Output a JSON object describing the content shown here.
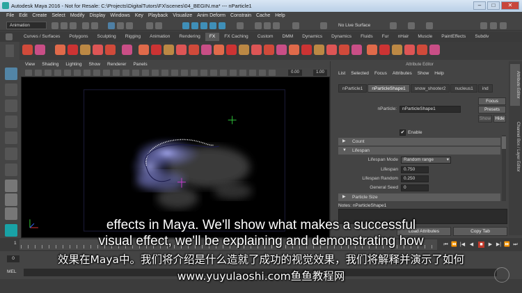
{
  "window": {
    "title": "Autodesk Maya 2016 - Not for Resale: C:\\Projects\\DigitalTutors\\FX\\scenes\\04_BEGIN.ma*  ---  nParticle1",
    "minimize": "–",
    "maximize": "□",
    "close": "✕"
  },
  "menubar": [
    "File",
    "Edit",
    "Create",
    "Select",
    "Modify",
    "Display",
    "Windows",
    "Key",
    "Playback",
    "Visualize",
    "Anim Deform",
    "Constrain",
    "Cache",
    "Help"
  ],
  "statusline": {
    "mode": "Animation",
    "live_surface": "No Live Surface"
  },
  "shelf": {
    "tabs": [
      "Curves / Surfaces",
      "Polygons",
      "Sculpting",
      "Rigging",
      "Animation",
      "Rendering",
      "FX",
      "FX Caching",
      "Custom",
      "DMM",
      "Dynamics",
      "Dynamics",
      "Fluids",
      "Fur",
      "nHair",
      "Muscle",
      "PaintEffects",
      "Subdiv"
    ],
    "active_tab": "FX"
  },
  "viewport": {
    "menu": [
      "View",
      "Shading",
      "Lighting",
      "Show",
      "Renderer",
      "Panels"
    ],
    "field_a": "0.00",
    "field_b": "1.00",
    "colors": {
      "background": "#000000",
      "particle_glow": "#8a8fe0",
      "smoke": "#6a6a6a",
      "curve": "#1a1a4a"
    }
  },
  "attribute_editor": {
    "header": "Attribute Editor",
    "menu": [
      "List",
      "Selected",
      "Focus",
      "Attributes",
      "Show",
      "Help"
    ],
    "tabs": [
      "nParticle1",
      "nParticleShape1",
      "snow_shooter2",
      "nucleus1",
      "ind"
    ],
    "active_tab": "nParticleShape1",
    "node_label": "nParticle:",
    "node_value": "nParticleShape1",
    "focus": "Focus",
    "presets": "Presets",
    "show": "Show",
    "hide": "Hide",
    "enable_label": "Enable",
    "enable_checked": "✔",
    "sections": {
      "count": "Count",
      "lifespan": "Lifespan",
      "particle_size": "Particle Size"
    },
    "fields": {
      "lifespan_mode_label": "Lifespan Mode",
      "lifespan_mode_value": "Random range",
      "lifespan_label": "Lifespan",
      "lifespan_value": "0.750",
      "lifespan_random_label": "Lifespan Random",
      "lifespan_random_value": "0.250",
      "general_seed_label": "General Seed",
      "general_seed_value": "0"
    },
    "notes_label": "Notes:  nParticleShape1",
    "buttons": {
      "load": "Load Attributes",
      "copy_tab": "Copy Tab"
    },
    "side_tabs": [
      "Attribute Editor",
      "Channel Box / Layer Editor"
    ]
  },
  "timeline": {
    "start": "1",
    "controls": [
      "⏮",
      "⏪",
      "|◀",
      "◀",
      "■",
      "▶",
      "▶|",
      "⏩",
      "⏭"
    ]
  },
  "range": {
    "start": "0"
  },
  "mel": {
    "label": "MEL"
  },
  "subtitles": {
    "line1": "effects in Maya. We'll show what makes a successful",
    "line2": "visual effect, we'll be explaining and demonstrating how",
    "line3": "效果在Maya中。我们将介绍是什么造就了成功的视觉效果，我们将解释并演示了如何",
    "line4": "www.yuyulaoshi.com鱼鱼教程网"
  }
}
